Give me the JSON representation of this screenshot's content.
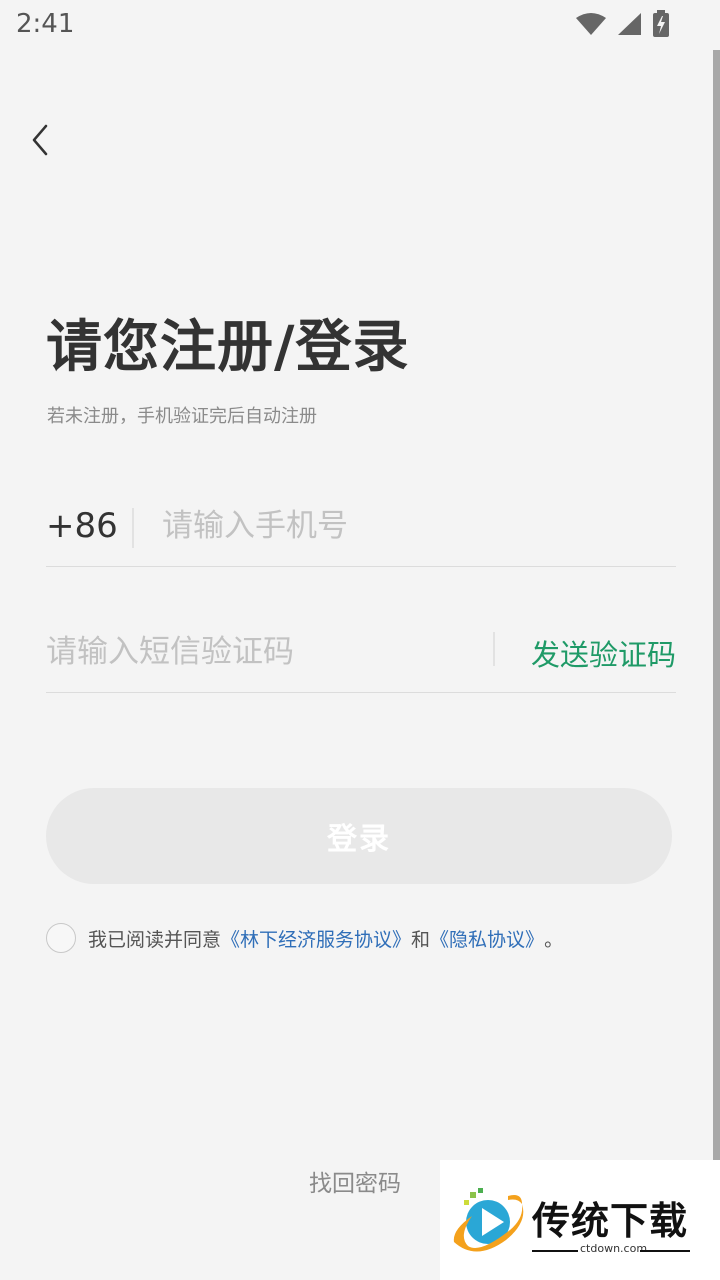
{
  "status_bar": {
    "time": "2:41",
    "icons": [
      "wifi-icon",
      "cell-signal-icon",
      "battery-charging-icon"
    ]
  },
  "header": {
    "back_icon": "chevron-left-icon"
  },
  "title": "请您注册/登录",
  "subtitle": "若未注册，手机验证完后自动注册",
  "phone": {
    "country_code": "+86",
    "value": "",
    "placeholder": "请输入手机号"
  },
  "sms_code": {
    "value": "",
    "placeholder": "请输入短信验证码",
    "send_label": "发送验证码"
  },
  "login_button": {
    "label": "登录"
  },
  "agreement": {
    "checked": false,
    "prefix": "我已阅读并同意",
    "service_link": "《林下经济服务协议》",
    "conjunction": "和",
    "privacy_link": "《隐私协议》",
    "suffix": "。"
  },
  "recover_password": "找回密码",
  "watermark": {
    "brand": "传统下载",
    "url": "ctdown.com"
  },
  "colors": {
    "background": "#f4f4f4",
    "accent_green": "#1f9a67",
    "link_blue": "#2f6eb8",
    "disabled_button": "#e8e8e8"
  }
}
